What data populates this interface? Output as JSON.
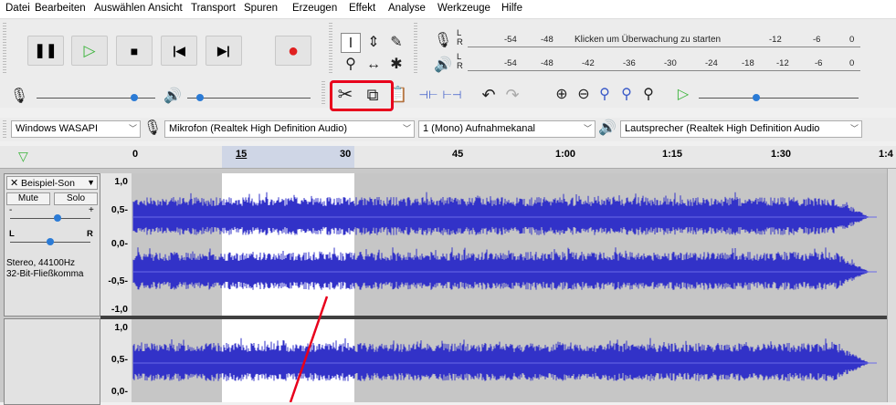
{
  "menu": [
    "Datei",
    "Bearbeiten",
    "Auswählen",
    "Ansicht",
    "Transport",
    "Spuren",
    "Erzeugen",
    "Effekt",
    "Analyse",
    "Werkzeuge",
    "Hilfe"
  ],
  "transport": {
    "pause": "pause-icon",
    "play": "play-icon",
    "stop": "stop-icon",
    "skip_start": "skip-to-start-icon",
    "skip_end": "skip-to-end-icon",
    "record": "record-icon"
  },
  "meters": {
    "rec_scale": [
      "-54",
      "-48",
      "-12",
      "-6",
      "0"
    ],
    "rec_hint": "Klicken um Überwachung zu starten",
    "play_scale": [
      "-54",
      "-48",
      "-42",
      "-36",
      "-30",
      "-24",
      "-18",
      "-12",
      "-6",
      "0"
    ],
    "lr": [
      "L",
      "R"
    ]
  },
  "devices": {
    "host": "Windows WASAPI",
    "mic": "Mikrofon (Realtek High Definition Audio)",
    "channels": "1 (Mono) Aufnahmekanal",
    "speaker": "Lautsprecher (Realtek High Definition Audio"
  },
  "timeline": {
    "labels": [
      "0",
      "15",
      "30",
      "45",
      "1:00",
      "1:15",
      "1:30",
      "1:4"
    ]
  },
  "track": {
    "name": "Beispiel-Son",
    "mute": "Mute",
    "solo": "Solo",
    "gain_minus": "-",
    "gain_plus": "+",
    "pan_l": "L",
    "pan_r": "R",
    "info1": "Stereo, 44100Hz",
    "info2": "32-Bit-Fließkomma",
    "ruler1": [
      "1,0",
      "0,5-",
      "0,0-",
      "-0,5-",
      "-1,0"
    ],
    "ruler2": [
      "1,0",
      "0,5-",
      "0,0-"
    ]
  },
  "colors": {
    "wave": "#3232c8",
    "highlight": "#e8001c"
  }
}
